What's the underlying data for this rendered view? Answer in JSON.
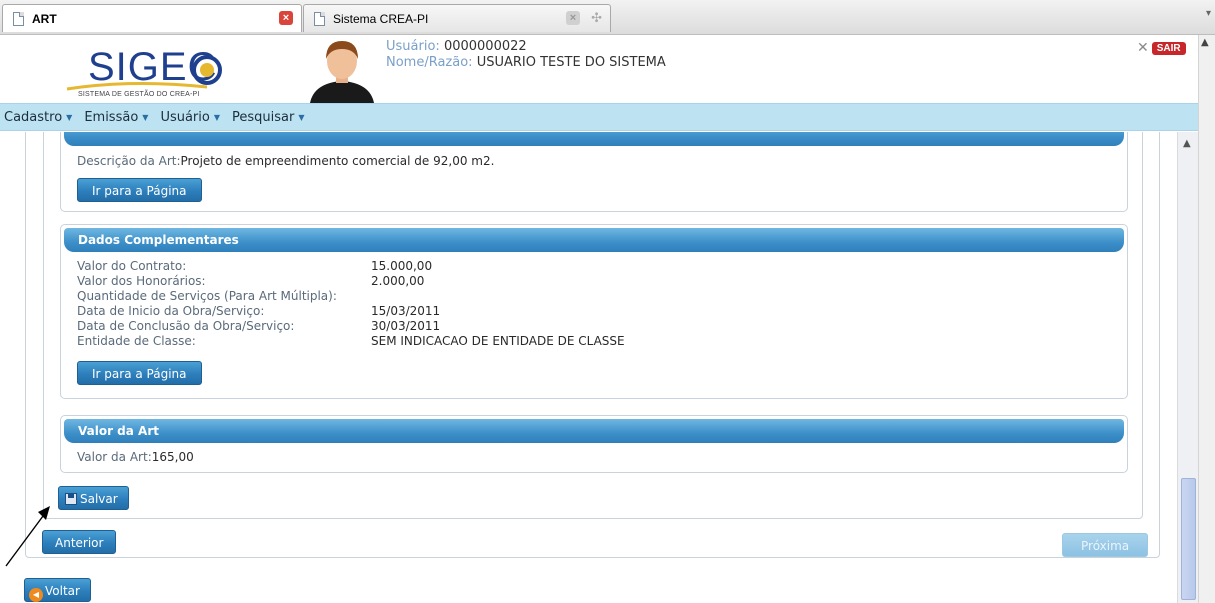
{
  "browser": {
    "tabs": [
      {
        "label": "ART",
        "active": true
      },
      {
        "label": "Sistema CREA-PI",
        "active": false
      }
    ]
  },
  "header": {
    "logo_text": "SIGEC",
    "logo_subtitle": "SISTEMA DE GESTÃO DO CREA-PI",
    "user_label": "Usuário:",
    "user_value": "0000000022",
    "name_label": "Nome/Razão:",
    "name_value": "USUARIO TESTE DO SISTEMA",
    "logout_label": "SAIR"
  },
  "menu": [
    {
      "label": "Cadastro"
    },
    {
      "label": "Emissão"
    },
    {
      "label": "Usuário"
    },
    {
      "label": "Pesquisar"
    }
  ],
  "panel_description": {
    "label": "Descrição da Art:",
    "value": "Projeto de empreendimento comercial de 92,00 m2.",
    "button": "Ir para a Página"
  },
  "panel_complementary": {
    "title": "Dados Complementares",
    "rows": [
      {
        "label": "Valor do Contrato:",
        "value": "15.000,00"
      },
      {
        "label": "Valor dos Honorários:",
        "value": "2.000,00"
      },
      {
        "label": "Quantidade de Serviços (Para Art Múltipla):",
        "value": ""
      },
      {
        "label": "Data de Inicio da Obra/Serviço:",
        "value": "15/03/2011"
      },
      {
        "label": "Data de Conclusão da Obra/Serviço:",
        "value": "30/03/2011"
      },
      {
        "label": "Entidade de Classe:",
        "value": "SEM INDICACAO DE ENTIDADE DE CLASSE"
      }
    ],
    "button": "Ir para a Página"
  },
  "panel_value": {
    "title": "Valor da Art",
    "label": "Valor da Art:",
    "value": "165,00"
  },
  "actions": {
    "save": "Salvar",
    "previous": "Anterior",
    "next": "Próxima",
    "back": "Voltar"
  },
  "colors": {
    "accent": "#2d7fbc",
    "menu_bg": "#bde3f3",
    "logout": "#c7262b"
  }
}
